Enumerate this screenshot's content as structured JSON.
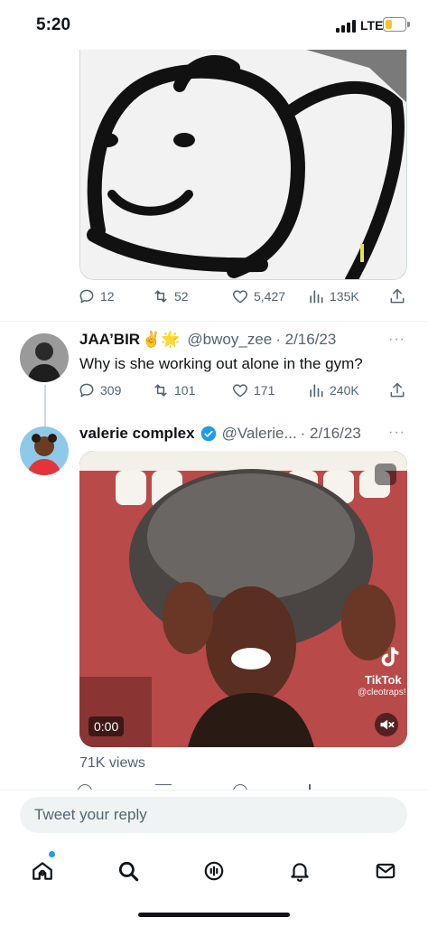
{
  "status_bar": {
    "time": "5:20",
    "network": "LTE",
    "battery_level": 0.35,
    "battery_color": "#f4c430"
  },
  "top_tweet": {
    "media_icon": "smiley-face-drawing",
    "stats": {
      "replies": "12",
      "retweets": "52",
      "likes": "5,427",
      "views": "135K"
    }
  },
  "reply_tweet": {
    "name": "JAA’BIR",
    "emoji": "✌️🌟",
    "handle": "@bwoy_zee",
    "date": "· 2/16/23",
    "more": "···",
    "text": "Why is she working out alone in the gym?",
    "stats": {
      "replies": "309",
      "retweets": "101",
      "likes": "171",
      "views": "240K"
    }
  },
  "quoted_tweet": {
    "name": "valerie complex",
    "verified": true,
    "handle": "@Valerie...",
    "date": "· 2/16/23",
    "more": "···",
    "video": {
      "time": "0:00",
      "watermark": "TikTok",
      "watermark_handle": "@cleotraps!"
    },
    "views_label": "71K views"
  },
  "composer": {
    "placeholder": "Tweet your reply"
  },
  "nav": {
    "items": [
      "home-icon",
      "search-icon",
      "spaces-icon",
      "notifications-icon",
      "messages-icon"
    ],
    "home_badge": true
  },
  "colors": {
    "accent": "#1d9bf0",
    "text": "#0f1419",
    "muted": "#536471",
    "verified": "#1d9bf0"
  }
}
